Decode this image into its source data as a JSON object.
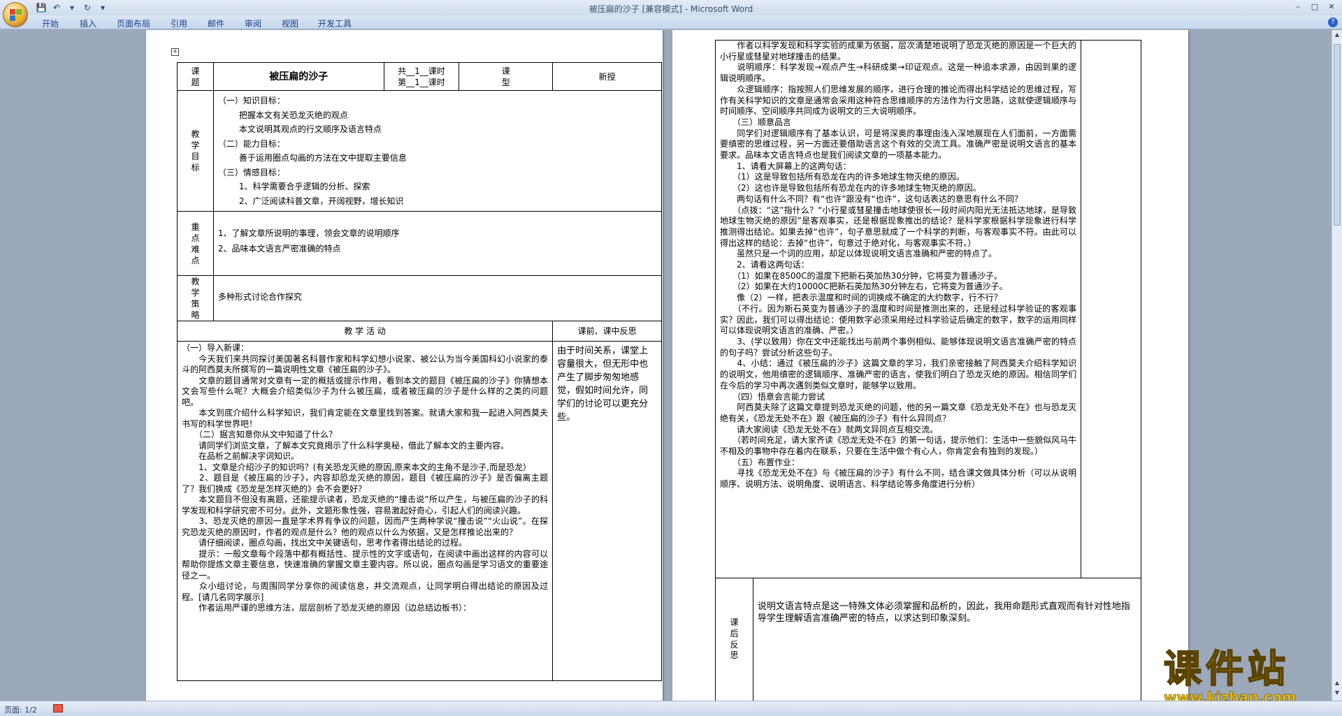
{
  "window": {
    "title": "被压扁的沙子 [兼容模式] - Microsoft Word"
  },
  "ribbon": {
    "tabs": [
      "开始",
      "插入",
      "页面布局",
      "引用",
      "邮件",
      "审阅",
      "视图",
      "开发工具"
    ]
  },
  "status": {
    "page": "页面: 1/2"
  },
  "watermark": {
    "big": "课件站",
    "small": "www.kjzhan.com"
  },
  "lesson": {
    "title_label": "课\n题",
    "title": "被压扁的沙子",
    "hours": "共__1__课时\n第__1__课时",
    "type_label": "课\n型",
    "type": "新授",
    "goals_label": "教\n学\n目\n标",
    "goals": [
      "（一）知识目标：",
      "把握本文有关恐龙灭绝的观点",
      "本文说明其观点的行文顺序及语言特点",
      "（二）能力目标：",
      "善于运用圈点勾画的方法在文中提取主要信息",
      "（三）情感目标：",
      "1、科学需要合乎逻辑的分析、探索",
      "2、广泛阅读科普文章，开阔视野，增长知识"
    ],
    "key_label": "重\n点\n难\n点",
    "key_points": [
      "1、了解文章所说明的事理，领会文章的说明顺序",
      "2、品味本文语言严密准确的特点"
    ],
    "strategy_label": "教\n学\n策\n略",
    "strategy": "多种形式讨论合作探究",
    "activity_header": "教  学  活  动",
    "reflection_header": "课前、课中反思",
    "reflection": "由于时间关系，课堂上容量很大，但无形中也产生了脚步匆匆地感觉，假如时间允许，同学们的讨论可以更充分些。",
    "activity": [
      "（一）导入新课：",
      "　　今天我们来共同探讨美国著名科普作家和科学幻想小说家、被公认为当今美国科幻小说家的泰斗的阿西莫夫所撰写的一篇说明性文章《被压扁的沙子》。",
      "　　文章的题目通常对文章有一定的概括或提示作用，看到本文的题目《被压扁的沙子》你猜想本文会写些什么呢？大概会介绍类似沙子为什么被压扁，或者被压扁的沙子是什么样的之类的问题吧。",
      "　　本文到底介绍什么科学知识，我们肯定能在文章里找到答案。就请大家和我一起进入阿西莫夫书写的科学世界吧！",
      "　　（二）据言知意你从文中知道了什么？",
      "　　请同学们浏览文章，了解本文究竟揭示了什么科学奥秘，借此了解本文的主要内容。",
      "　　在品析之前解决字词知识。",
      "　　1、文章是介绍沙子的知识吗？(有关恐龙灭绝的原因,原来本文的主角不是沙子,而是恐龙）",
      "　　2、题目是《被压扁的沙子》，内容却恐龙灭绝的原因，题目《被压扁的沙子》是否偏离主题了？我们换成《恐龙是怎样灭绝的》会不会更好？",
      "　　本文题目不但没有离题，还能提示读者，恐龙灭绝的“撞击说”所以产生，与被压扁的沙子的科学发现和科学研究密不可分。此外，文题形象性强，容易激起好奇心，引起人们的阅读兴趣。",
      "　　3、恐龙灭绝的原因一直是学术界有争议的问题，因而产生两种学说“撞击说”“火山说”。在探究恐龙灭绝的原因时，作者的观点是什么？他的观点以什么为依据，又是怎样推论出来的？",
      "　　请仔细阅读，圈点勾画，找出文中关键语句，思考作者得出结论的过程。",
      "　　提示：一般文章每个段落中都有概括性、提示性的文字或语句，在阅读中画出这样的内容可以帮助你提炼文章主要信息，快速准确的掌握文章主要内容。所以说，圈点勾画是学习语文的重要途径之一。",
      "　　众小组讨论，与周围同学分享你的阅读信息，并交流观点，让同学明白得出结论的原因及过程。[请几名同学展示]",
      "　　作者运用严谨的思维方法，层层剖析了恐龙灭绝的原因（边总结边板书）："
    ]
  },
  "page2": {
    "paragraphs": [
      "　　作者以科学发现和科学实验的成果为依据，层次清楚地说明了恐龙灭绝的原因是一个巨大的小行星或彗星对地球撞击的结果。",
      "　　说明顺序：科学发现→观点产生→科研成果→印证观点。这是一种追本求源，由因到果的逻辑说明顺序。",
      "　　众逻辑顺序：指按照人们思维发展的顺序，进行合理的推论而得出科学结论的思维过程，写作有关科学知识的文章是通常会采用这种符合思维顺序的方法作为行文思路，这就使逻辑顺序与时间顺序、空间顺序共同成为说明文的三大说明顺序。",
      "　　（三）顺意品言",
      "　　同学们对逻辑顺序有了基本认识，可是将深奥的事理由浅入深地展现在人们面前，一方面需要缜密的思维过程，另一方面还要借助语言这个有效的交流工具。准确严密是说明文语言的基本要求。品味本文语言特点也是我们阅读文章的一项基本能力。",
      "　　1、请看大屏幕上的这两句话：",
      "　　（1）这是导致包括所有恐龙在内的许多地球生物灭绝的原因。",
      "　　（2）这也许是导致包括所有恐龙在内的许多地球生物灭绝的原因。",
      "　　两句话有什么不同？有“也许”跟没有“也许”，这句话表达的意思有什么不同？",
      "　　（点拨：“这”指什么？“小行星或彗星撞击地球使很长一段时间内阳光无法抵达地球，是导致地球生物灭绝的原因”是客观事实，还是根据现象推出的结论？是科学家根据科学现象进行科学推测得出结论。如果去掉“也许”，句子意思就成了一个科学的判断，与客观事实不符。由此可以得出这样的结论：去掉“也许”，句意过于绝对化，与客观事实不符。）",
      "　　虽然只是一个词的应用，却足以体现说明文语言准确和严密的特点了。",
      "　　2、请看这两句话：",
      "　　（1）如果在8500C的温度下把新石英加热30分钟，它将变为普通沙子。",
      "　　（2）如果在大约10000C把新石英加热30分钟左右，它将变为普通沙子。",
      "　　像（2）一样，把表示温度和时间的词换成不确定的大约数字，行不行？",
      "　　（不行。因为斯石英变为普通沙子的温度和时间是推测出来的，还是经过科学验证的客观事实？因此，我们可以得出结论：使用数字必须采用经过科学验证后确定的数字，数字的运用同样可以体现说明文语言的准确、严密。）",
      "　　3、(学以致用）你在文中还能找出与前两个事例相似、能够体现说明文语言准确严密的特点的句子吗？尝试分析这些句子。",
      "　　4、小结：通过《被压扁的沙子》这篇文章的学习，我们亲密接触了阿西莫夫介绍科学知识的说明文，他用缜密的逻辑顺序、准确严密的语言，使我们明白了恐龙灭绝的原因。相信同学们在今后的学习中再次遇到类似文章时，能够学以致用。",
      "　　（四）悟意会言能力尝试",
      "　　阿西莫夫除了这篇文章提到恐龙灭绝的问题，他的另一篇文章《恐龙无处不在》也与恐龙灭绝有关，《恐龙无处不在》跟《被压扁的沙子》有什么异同点？",
      "　　请大家阅读《恐龙无处不在》就两文异同点互相交流。",
      "　　（若时间充足，请大家齐读《恐龙无处不在》的第一句话，提示他们：生活中一些貌似风马牛不相及的事物中存在着内在联系，只要在生活中做个有心人，你肯定会有独到的发现。）",
      "　　（五）布置作业：",
      "　　寻找《恐龙无处不在》与《被压扁的沙子》有什么不同，结合课文做具体分析（可以从说明顺序、说明方法、说明角度、说明语言、科学结论等多角度进行分析）"
    ],
    "after_label": "课\n后\n反\n思",
    "after_text": "说明文语言特点是这一特殊文体必须掌握和品析的，因此，我用命题形式直观而有针对性地指导学生理解语言准确严密的特点，以求达到印象深刻。"
  }
}
